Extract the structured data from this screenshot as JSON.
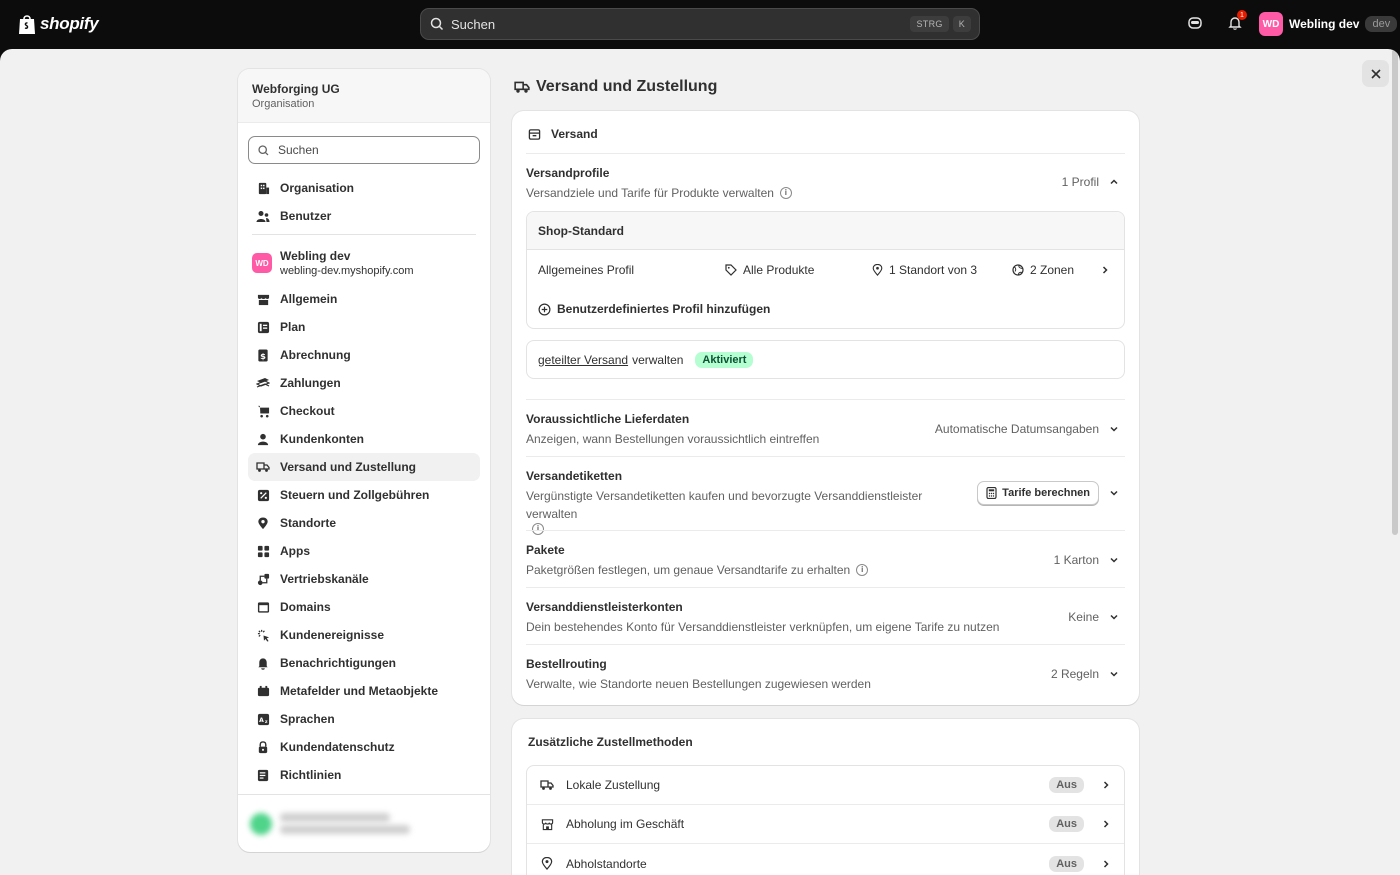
{
  "topbar": {
    "logo_text": "shopify",
    "search_placeholder": "Suchen",
    "kbd_ctrl": "STRG",
    "kbd_k": "K",
    "notification_count": "1",
    "user_initials": "WD",
    "user_name": "Webling dev",
    "user_tag": "dev"
  },
  "sidebar": {
    "org_name": "Webforging UG",
    "org_sub": "Organisation",
    "search_placeholder": "Suchen",
    "org_items": [
      {
        "label": "Organisation",
        "icon": "building-icon"
      },
      {
        "label": "Benutzer",
        "icon": "users-icon"
      }
    ],
    "store": {
      "initials": "WD",
      "name": "Webling dev",
      "url": "webling-dev.myshopify.com"
    },
    "items": [
      {
        "label": "Allgemein",
        "icon": "store-icon"
      },
      {
        "label": "Plan",
        "icon": "plan-icon"
      },
      {
        "label": "Abrechnung",
        "icon": "billing-icon"
      },
      {
        "label": "Zahlungen",
        "icon": "payments-icon"
      },
      {
        "label": "Checkout",
        "icon": "cart-icon"
      },
      {
        "label": "Kundenkonten",
        "icon": "person-icon"
      },
      {
        "label": "Versand und Zustellung",
        "icon": "truck-icon"
      },
      {
        "label": "Steuern und Zollgebühren",
        "icon": "tax-icon"
      },
      {
        "label": "Standorte",
        "icon": "location-icon"
      },
      {
        "label": "Apps",
        "icon": "apps-icon"
      },
      {
        "label": "Vertriebskanäle",
        "icon": "channels-icon"
      },
      {
        "label": "Domains",
        "icon": "domains-icon"
      },
      {
        "label": "Kundenereignisse",
        "icon": "events-icon"
      },
      {
        "label": "Benachrichtigungen",
        "icon": "bell-icon"
      },
      {
        "label": "Metafelder und Metaobjekte",
        "icon": "metafields-icon"
      },
      {
        "label": "Sprachen",
        "icon": "language-icon"
      },
      {
        "label": "Kundendatenschutz",
        "icon": "lock-icon"
      },
      {
        "label": "Richtlinien",
        "icon": "policy-icon"
      }
    ],
    "active_item": "Versand und Zustellung"
  },
  "page": {
    "title": "Versand und Zustellung"
  },
  "shipping_card": {
    "heading": "Versand",
    "profiles": {
      "title": "Versandprofile",
      "desc": "Versandziele und Tarife für Produkte verwalten",
      "value": "1 Profil",
      "box_title": "Shop-Standard",
      "general_profile": "Allgemeines Profil",
      "products": "Alle Produkte",
      "locations": "1 Standort von 3",
      "zones": "2 Zonen",
      "add_label": "Benutzerdefiniertes Profil hinzufügen"
    },
    "shared": {
      "link": "geteilter Versand",
      "rest": "verwalten",
      "badge": "Aktiviert"
    },
    "delivery_dates": {
      "title": "Voraussichtliche Lieferdaten",
      "desc": "Anzeigen, wann Bestellungen voraussichtlich eintreffen",
      "value": "Automatische Datumsangaben"
    },
    "labels": {
      "title": "Versandetiketten",
      "desc": "Vergünstigte Versandetiketten kaufen und bevorzugte Versanddienstleister verwalten",
      "button": "Tarife berechnen"
    },
    "packages": {
      "title": "Pakete",
      "desc": "Paketgrößen festlegen, um genaue Versandtarife zu erhalten",
      "value": "1 Karton"
    },
    "carrier_accounts": {
      "title": "Versanddienstleisterkonten",
      "desc": "Dein bestehendes Konto für Versanddienstleister verknüpfen, um eigene Tarife zu nutzen",
      "value": "Keine"
    },
    "routing": {
      "title": "Bestellrouting",
      "desc": "Verwalte, wie Standorte neuen Bestellungen zugewiesen werden",
      "value": "2 Regeln"
    }
  },
  "delivery_methods_card": {
    "heading": "Zusätzliche Zustellmethoden",
    "items": [
      {
        "label": "Lokale Zustellung",
        "status": "Aus",
        "icon": "delivery-truck-icon"
      },
      {
        "label": "Abholung im Geschäft",
        "status": "Aus",
        "icon": "storefront-icon"
      },
      {
        "label": "Abholstandorte",
        "status": "Aus",
        "icon": "pin-icon"
      }
    ]
  },
  "colors": {
    "topbar": "#0c0c0c",
    "background": "#f1f1f1",
    "badge_success": "#b4fed2",
    "avatar_pink": "#ff5aa5"
  }
}
